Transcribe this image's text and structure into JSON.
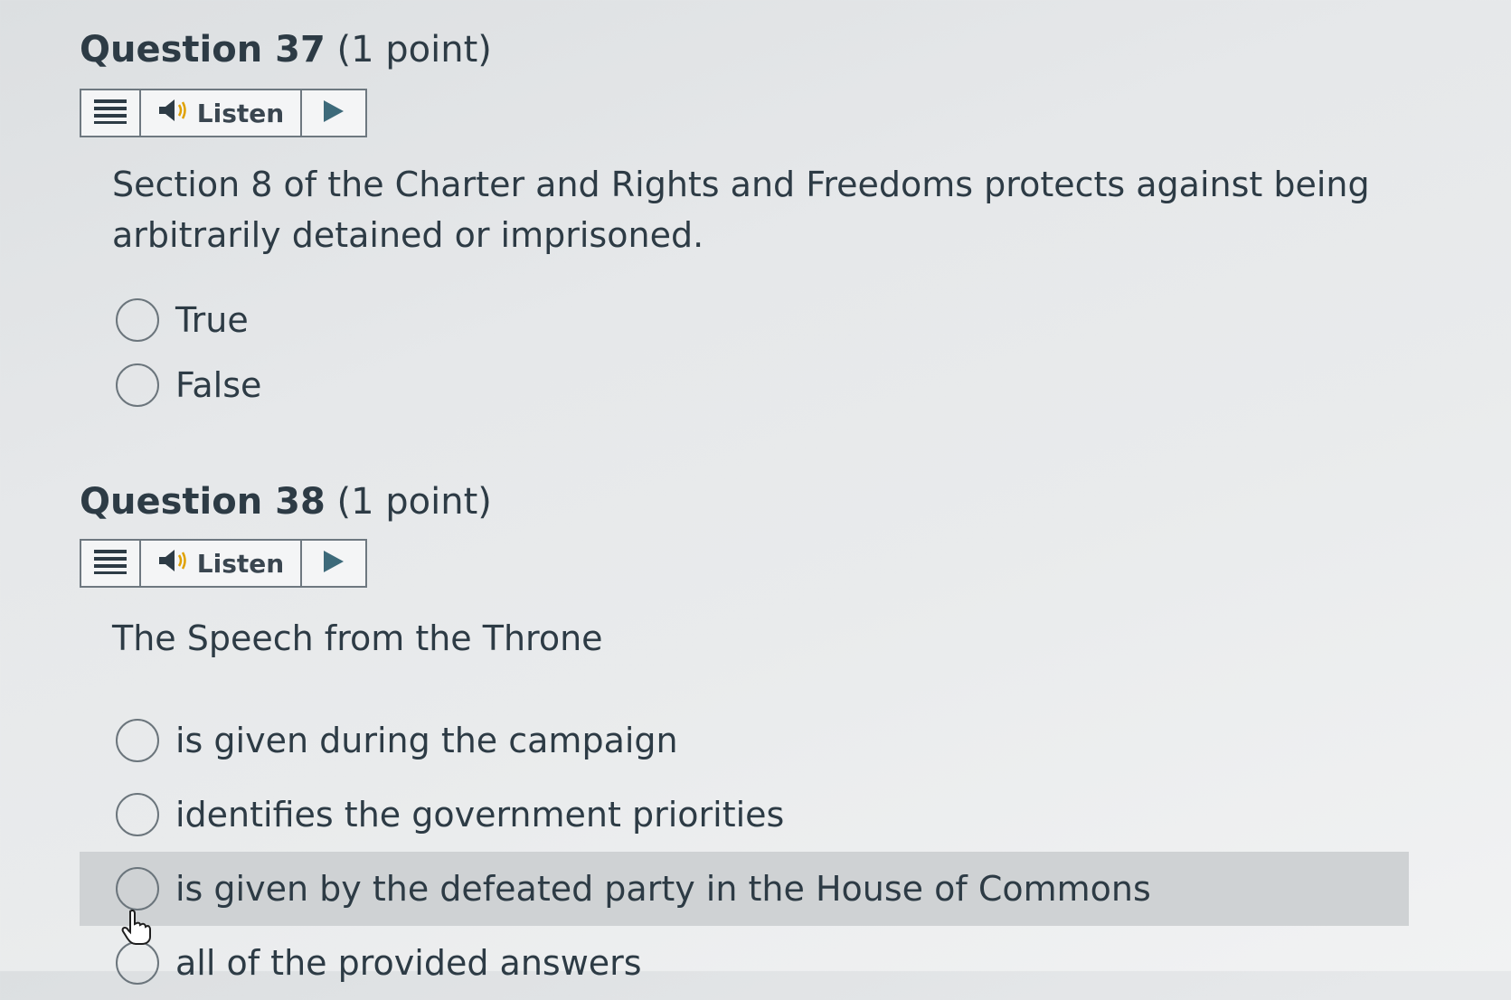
{
  "questions": [
    {
      "title": "Question 37",
      "points": "(1 point)",
      "listen": {
        "label": "Listen"
      },
      "text": "Section 8 of the Charter and Rights and Freedoms protects against being arbitrarily detained or imprisoned.",
      "options": [
        "True",
        "False"
      ]
    },
    {
      "title": "Question 38",
      "points": "(1 point)",
      "listen": {
        "label": "Listen"
      },
      "text": "The Speech from the Throne",
      "options": [
        "is given during the campaign",
        "identifies the government priorities",
        "is given by the defeated party in the House of Commons",
        "all of the provided answers"
      ],
      "hovered_option": "is given by the defeated party in the House of Commons"
    }
  ],
  "icons": {
    "menu": "menu-icon",
    "speaker": "speaker-icon",
    "play": "play-icon",
    "cursor": "hand-pointer-icon"
  },
  "colors": {
    "text": "#2d3b45",
    "hover_row": "#cfd2d4",
    "border": "#6e7880"
  }
}
